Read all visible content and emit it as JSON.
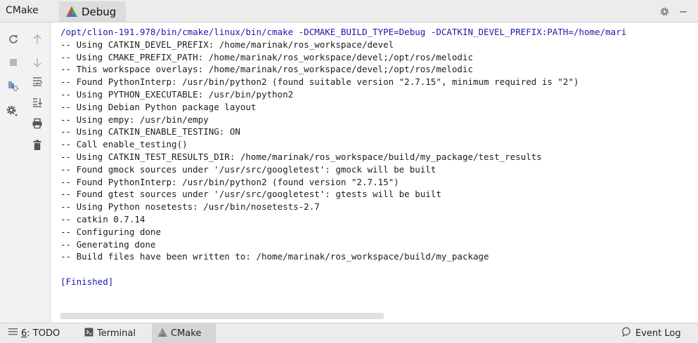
{
  "header": {
    "tool_title": "CMake",
    "tab_label": "Debug"
  },
  "console": {
    "command": "/opt/clion-191.978/bin/cmake/linux/bin/cmake -DCMAKE_BUILD_TYPE=Debug -DCATKIN_DEVEL_PREFIX:PATH=/home/mari",
    "lines": [
      "-- Using CATKIN_DEVEL_PREFIX: /home/marinak/ros_workspace/devel",
      "-- Using CMAKE_PREFIX_PATH: /home/marinak/ros_workspace/devel;/opt/ros/melodic",
      "-- This workspace overlays: /home/marinak/ros_workspace/devel;/opt/ros/melodic",
      "-- Found PythonInterp: /usr/bin/python2 (found suitable version \"2.7.15\", minimum required is \"2\")",
      "-- Using PYTHON_EXECUTABLE: /usr/bin/python2",
      "-- Using Debian Python package layout",
      "-- Using empy: /usr/bin/empy",
      "-- Using CATKIN_ENABLE_TESTING: ON",
      "-- Call enable_testing()",
      "-- Using CATKIN_TEST_RESULTS_DIR: /home/marinak/ros_workspace/build/my_package/test_results",
      "-- Found gmock sources under '/usr/src/googletest': gmock will be built",
      "-- Found PythonInterp: /usr/bin/python2 (found version \"2.7.15\")",
      "-- Found gtest sources under '/usr/src/googletest': gtests will be built",
      "-- Using Python nosetests: /usr/bin/nosetests-2.7",
      "-- catkin 0.7.14",
      "-- Configuring done",
      "-- Generating done",
      "-- Build files have been written to: /home/marinak/ros_workspace/build/my_package"
    ],
    "finished": "[Finished]"
  },
  "statusbar": {
    "todo_number": "6",
    "todo_label": ": TODO",
    "terminal_label": "Terminal",
    "cmake_label": "CMake",
    "event_log_label": "Event Log"
  },
  "icons": {
    "tab_icon": "cmake-triangle-icon",
    "header_settings": "gear-icon",
    "header_minimize": "minimize-icon",
    "left_toolbar": [
      "reload-icon",
      "scroll-up-icon",
      "stop-icon",
      "scroll-down-icon",
      "soft-wrap-icon",
      "cmake-settings-icon",
      "scroll-to-end-icon",
      "gear-icon",
      "print-icon",
      "trash-icon"
    ],
    "status": [
      "list-icon",
      "terminal-icon",
      "cmake-triangle-icon",
      "event-log-icon"
    ]
  },
  "colors": {
    "cmake_red": "#d64541",
    "cmake_blue": "#3d6fd1",
    "cmake_green": "#4aa14a",
    "console_command": "#1a1ab0"
  }
}
